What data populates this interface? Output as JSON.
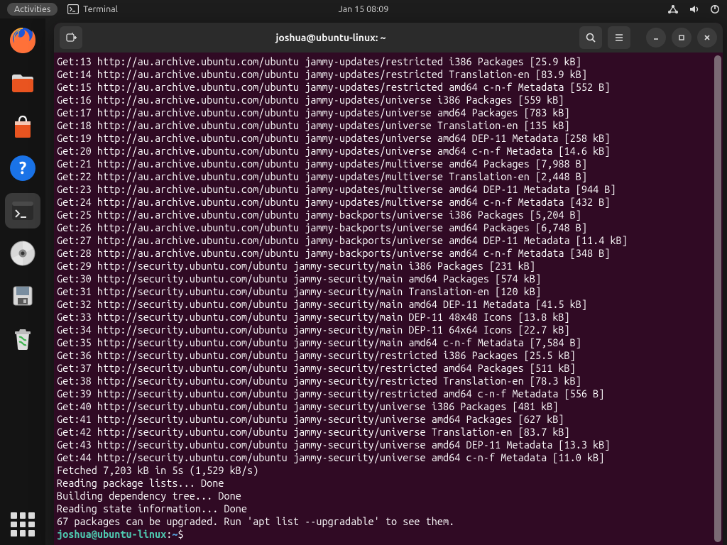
{
  "topbar": {
    "activities": "Activities",
    "app_label": "Terminal",
    "datetime": "Jan 15  08:09"
  },
  "window": {
    "title": "joshua@ubuntu-linux: ~"
  },
  "terminal": {
    "lines": [
      "Get:13 http://au.archive.ubuntu.com/ubuntu jammy-updates/restricted i386 Packages [25.9 kB]",
      "Get:14 http://au.archive.ubuntu.com/ubuntu jammy-updates/restricted Translation-en [83.9 kB]",
      "Get:15 http://au.archive.ubuntu.com/ubuntu jammy-updates/restricted amd64 c-n-f Metadata [552 B]",
      "Get:16 http://au.archive.ubuntu.com/ubuntu jammy-updates/universe i386 Packages [559 kB]",
      "Get:17 http://au.archive.ubuntu.com/ubuntu jammy-updates/universe amd64 Packages [783 kB]",
      "Get:18 http://au.archive.ubuntu.com/ubuntu jammy-updates/universe Translation-en [135 kB]",
      "Get:19 http://au.archive.ubuntu.com/ubuntu jammy-updates/universe amd64 DEP-11 Metadata [258 kB]",
      "Get:20 http://au.archive.ubuntu.com/ubuntu jammy-updates/universe amd64 c-n-f Metadata [14.6 kB]",
      "Get:21 http://au.archive.ubuntu.com/ubuntu jammy-updates/multiverse amd64 Packages [7,988 B]",
      "Get:22 http://au.archive.ubuntu.com/ubuntu jammy-updates/multiverse Translation-en [2,448 B]",
      "Get:23 http://au.archive.ubuntu.com/ubuntu jammy-updates/multiverse amd64 DEP-11 Metadata [944 B]",
      "Get:24 http://au.archive.ubuntu.com/ubuntu jammy-updates/multiverse amd64 c-n-f Metadata [432 B]",
      "Get:25 http://au.archive.ubuntu.com/ubuntu jammy-backports/universe i386 Packages [5,204 B]",
      "Get:26 http://au.archive.ubuntu.com/ubuntu jammy-backports/universe amd64 Packages [6,748 B]",
      "Get:27 http://au.archive.ubuntu.com/ubuntu jammy-backports/universe amd64 DEP-11 Metadata [11.4 kB]",
      "Get:28 http://au.archive.ubuntu.com/ubuntu jammy-backports/universe amd64 c-n-f Metadata [348 B]",
      "Get:29 http://security.ubuntu.com/ubuntu jammy-security/main i386 Packages [231 kB]",
      "Get:30 http://security.ubuntu.com/ubuntu jammy-security/main amd64 Packages [574 kB]",
      "Get:31 http://security.ubuntu.com/ubuntu jammy-security/main Translation-en [120 kB]",
      "Get:32 http://security.ubuntu.com/ubuntu jammy-security/main amd64 DEP-11 Metadata [41.5 kB]",
      "Get:33 http://security.ubuntu.com/ubuntu jammy-security/main DEP-11 48x48 Icons [13.8 kB]",
      "Get:34 http://security.ubuntu.com/ubuntu jammy-security/main DEP-11 64x64 Icons [22.7 kB]",
      "Get:35 http://security.ubuntu.com/ubuntu jammy-security/main amd64 c-n-f Metadata [7,584 B]",
      "Get:36 http://security.ubuntu.com/ubuntu jammy-security/restricted i386 Packages [25.5 kB]",
      "Get:37 http://security.ubuntu.com/ubuntu jammy-security/restricted amd64 Packages [511 kB]",
      "Get:38 http://security.ubuntu.com/ubuntu jammy-security/restricted Translation-en [78.3 kB]",
      "Get:39 http://security.ubuntu.com/ubuntu jammy-security/restricted amd64 c-n-f Metadata [556 B]",
      "Get:40 http://security.ubuntu.com/ubuntu jammy-security/universe i386 Packages [481 kB]",
      "Get:41 http://security.ubuntu.com/ubuntu jammy-security/universe amd64 Packages [627 kB]",
      "Get:42 http://security.ubuntu.com/ubuntu jammy-security/universe Translation-en [83.7 kB]",
      "Get:43 http://security.ubuntu.com/ubuntu jammy-security/universe amd64 DEP-11 Metadata [13.3 kB]",
      "Get:44 http://security.ubuntu.com/ubuntu jammy-security/universe amd64 c-n-f Metadata [11.0 kB]",
      "Fetched 7,203 kB in 5s (1,529 kB/s)",
      "Reading package lists... Done",
      "Building dependency tree... Done",
      "Reading state information... Done",
      "67 packages can be upgraded. Run 'apt list --upgradable' to see them."
    ],
    "prompt_user": "joshua@ubuntu-linux",
    "prompt_sep": ":",
    "prompt_path": "~",
    "prompt_end": "$"
  }
}
